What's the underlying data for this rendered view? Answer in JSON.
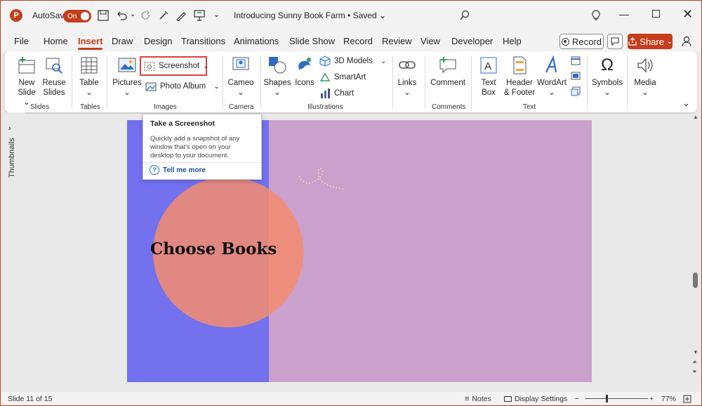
{
  "titlebar": {
    "app_logo": "P",
    "autosave_label": "AutoSave",
    "autosave_state": "On",
    "doc_title": "Introducing Sunny Book Farm • Saved",
    "doc_title_chevron": "⌄"
  },
  "tabs": [
    "File",
    "Home",
    "Insert",
    "Draw",
    "Design",
    "Transitions",
    "Animations",
    "Slide Show",
    "Record",
    "Review",
    "View",
    "Developer",
    "Help"
  ],
  "active_tab": "Insert",
  "actions": {
    "record": "Record",
    "share": "Share"
  },
  "ribbon": {
    "slides": {
      "group": "Slides",
      "new_slide": "New",
      "new_slide2": "Slide",
      "reuse": "Reuse",
      "reuse2": "Slides"
    },
    "tables": {
      "group": "Tables",
      "table": "Table"
    },
    "images": {
      "group": "Images",
      "pictures": "Pictures",
      "screenshot": "Screenshot",
      "photo_album": "Photo Album"
    },
    "camera": {
      "group": "Camera",
      "cameo": "Cameo"
    },
    "illustrations": {
      "group": "Illustrations",
      "shapes": "Shapes",
      "icons": "Icons",
      "models": "3D Models",
      "smartart": "SmartArt",
      "chart": "Chart"
    },
    "links": {
      "links": "Links"
    },
    "comments": {
      "group": "Comments",
      "comment": "Comment"
    },
    "text": {
      "group": "Text",
      "textbox": "Text",
      "textbox2": "Box",
      "header": "Header",
      "header2": "& Footer",
      "wordart": "WordArt"
    },
    "symbols": {
      "symbols": "Symbols"
    },
    "media": {
      "media": "Media"
    }
  },
  "tooltip": {
    "title": "Take a Screenshot",
    "body": "Quickly add a snapshot of any window that's open on your desktop to your document.",
    "link": "Tell me more"
  },
  "side_panel": {
    "thumbnails": "Thumbnails"
  },
  "slide": {
    "title": "Choose Books"
  },
  "status": {
    "slide_count": "Slide 11 of 15",
    "notes": "Notes",
    "display": "Display Settings",
    "zoom": "77%"
  },
  "colors": {
    "accent": "#c43e1c",
    "slide_bg": "#caa0cc",
    "slide_blue": "#7371ee",
    "circle": "#f08a6e"
  }
}
